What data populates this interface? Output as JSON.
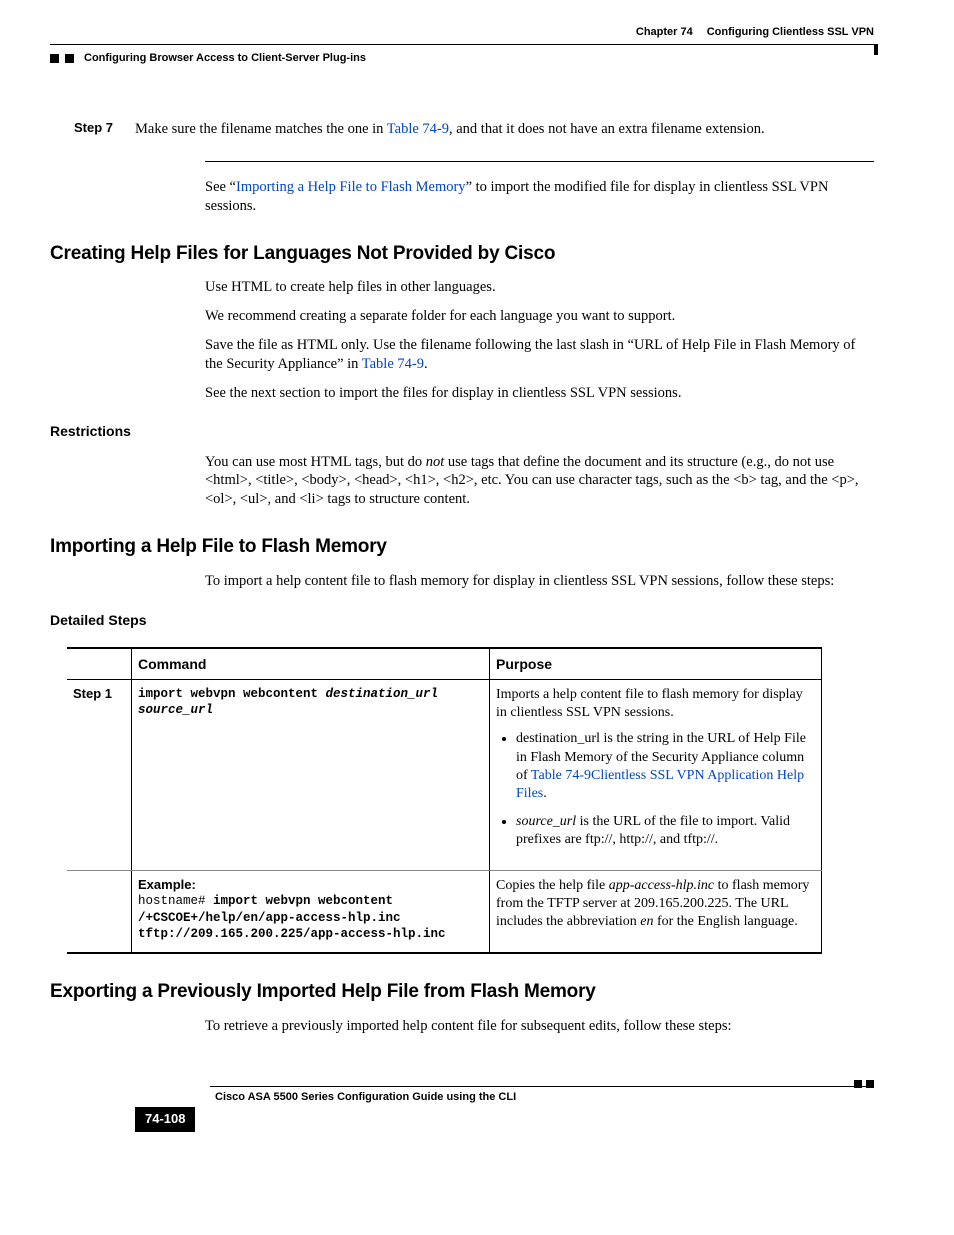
{
  "header": {
    "chapter": "Chapter 74",
    "chapter_title": "Configuring Clientless SSL VPN",
    "section": "Configuring Browser Access to Client-Server Plug-ins"
  },
  "step7": {
    "label": "Step 7",
    "text_a": "Make sure the filename matches the one in ",
    "link": "Table 74-9",
    "text_b": ", and that it does not have an extra filename extension."
  },
  "see_import": {
    "a": "See “",
    "link": "Importing a Help File to Flash Memory",
    "b": "” to import the modified file for display in clientless SSL VPN sessions."
  },
  "h2a": "Creating Help Files for Languages Not Provided by Cisco",
  "p1": "Use HTML to create help files in other languages.",
  "p2": "We recommend creating a separate folder for each language you want to support.",
  "p3a": "Save the file as HTML only. Use the filename following the last slash in “URL of Help File in Flash Memory of the Security Appliance” in ",
  "p3link": "Table 74-9",
  "p3b": ".",
  "p4": "See the next section to import the files for display in clientless SSL VPN sessions.",
  "h3a": "Restrictions",
  "restr_a": "You can use most HTML tags, but do ",
  "restr_not": "not",
  "restr_b": " use tags that define the document and its structure (e.g., do not use <html>, <title>, <body>, <head>, <h1>, <h2>, etc. You can use character tags, such as the <b> tag, and the <p>, <ol>, <ul>, and <li> tags to structure content.",
  "h2b": "Importing a Help File to Flash Memory",
  "p5": "To import a help content file to flash memory for display in clientless SSL VPN sessions, follow these steps:",
  "h3b": "Detailed Steps",
  "table": {
    "th1": "Command",
    "th2": "Purpose",
    "row1": {
      "step": "Step 1",
      "cmd_strong": "import webvpn webcontent ",
      "cmd_italic": "destination_url source_url",
      "purpose_intro": "Imports a help content file to flash memory for display in clientless SSL VPN sessions.",
      "b1a": "destination_url is the string in the URL of Help File in Flash Memory of the Security Appliance column of ",
      "b1link": "Table 74-9Clientless SSL VPN Application Help Files",
      "b1b": ".",
      "b2a_i": "source_url",
      "b2b": " is the URL of the file to import. Valid prefixes are ftp://, http://, and tftp://."
    },
    "row2": {
      "ex_label": "Example:",
      "ex_line1": "hostname# ",
      "ex_line1b": "import webvpn webcontent /+CSCOE+/help/en/app-access-hlp.inc tftp://209.165.200.225/app-access-hlp.inc",
      "purpose_a": "Copies the help file ",
      "purpose_i1": "app-access-hlp.inc",
      "purpose_b": " to flash memory from the TFTP server at 209.165.200.225. The URL includes the abbreviation ",
      "purpose_i2": "en",
      "purpose_c": " for the English language."
    }
  },
  "h2c": "Exporting a Previously Imported Help File from Flash Memory",
  "p6": "To retrieve a previously imported help content file for subsequent edits, follow these steps:",
  "footer": {
    "guide": "Cisco ASA 5500 Series Configuration Guide using the CLI",
    "page": "74-108"
  }
}
